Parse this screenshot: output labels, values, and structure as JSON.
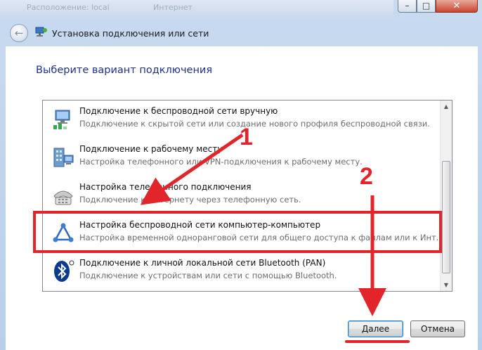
{
  "background_window": {
    "text_left": "Расположение: local",
    "text_right": "Интернет"
  },
  "window": {
    "title": "Установка подключения или сети"
  },
  "heading": "Выберите вариант подключения",
  "options": [
    {
      "title": "Подключение к беспроводной сети вручную",
      "description": "Подключение к скрытой сети или создание нового профиля беспроводной связи.",
      "icon": "wireless-network-icon"
    },
    {
      "title": "Подключение к рабочему месту",
      "description": "Настройка телефонного или VPN-подключения к рабочему месту.",
      "icon": "workplace-network-icon"
    },
    {
      "title": "Настройка телефонного подключения",
      "description": "Подключение к Интернету через телефонную сеть.",
      "icon": "dialup-phone-icon"
    },
    {
      "title": "Настройка беспроводной сети компьютер-компьютер",
      "description": "Настройка временной одноранговой сети для общего доступа к файлам или к Инт...",
      "icon": "adhoc-network-icon"
    },
    {
      "title": "Подключение к личной локальной сети Bluetooth (PAN)",
      "description": "Подключение к устройствам или сети с помощью Bluetooth.",
      "icon": "bluetooth-icon"
    }
  ],
  "annotations": {
    "step1": "1",
    "step2": "2"
  },
  "buttons": {
    "next": "Далее",
    "cancel": "Отмена"
  },
  "colors": {
    "annotation": "#e2252b",
    "heading": "#1e3287",
    "selection_border": "#e2252b"
  }
}
